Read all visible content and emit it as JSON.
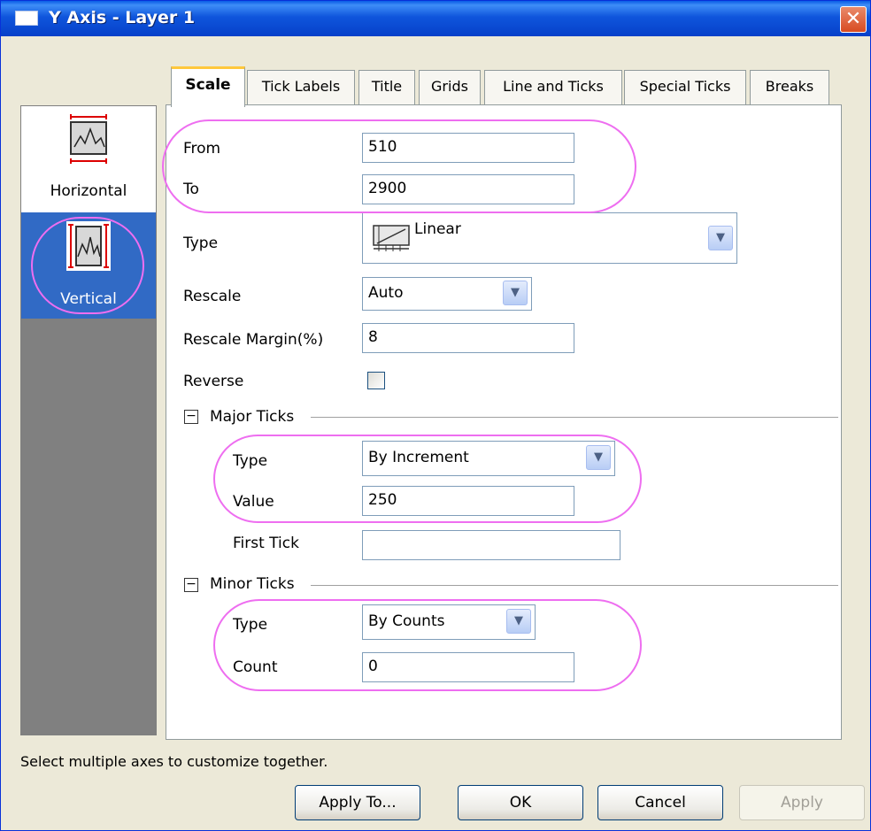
{
  "window": {
    "title": "Y Axis - Layer 1",
    "close_glyph": "✕"
  },
  "left_panel": {
    "items": [
      {
        "label": "Horizontal",
        "icon": "horizontal-axis-icon",
        "selected": false
      },
      {
        "label": "Vertical",
        "icon": "vertical-axis-icon",
        "selected": true
      }
    ]
  },
  "tabs": [
    {
      "label": "Scale",
      "active": true
    },
    {
      "label": "Tick Labels"
    },
    {
      "label": "Title"
    },
    {
      "label": "Grids"
    },
    {
      "label": "Line and Ticks"
    },
    {
      "label": "Special Ticks"
    },
    {
      "label": "Breaks"
    }
  ],
  "scale": {
    "from_label": "From",
    "from_value": "510",
    "to_label": "To",
    "to_value": "2900",
    "type_label": "Type",
    "type_value": "Linear",
    "type_icon": "linear-scale-icon",
    "rescale_label": "Rescale",
    "rescale_value": "Auto",
    "rescale_margin_label": "Rescale Margin(%)",
    "rescale_margin_value": "8",
    "reverse_label": "Reverse",
    "reverse_checked": false
  },
  "major_ticks": {
    "header": "Major Ticks",
    "expander_glyph": "−",
    "type_label": "Type",
    "type_value": "By Increment",
    "value_label": "Value",
    "value_value": "250",
    "first_tick_label": "First Tick",
    "first_tick_value": ""
  },
  "minor_ticks": {
    "header": "Minor Ticks",
    "expander_glyph": "−",
    "type_label": "Type",
    "type_value": "By Counts",
    "count_label": "Count",
    "count_value": "0"
  },
  "status_text": "Select multiple axes to customize together.",
  "buttons": {
    "apply_to": "Apply To...",
    "ok": "OK",
    "cancel": "Cancel",
    "apply": "Apply"
  },
  "colors": {
    "title_bar": "#0a5ce6",
    "selection": "#316ac5",
    "highlight_oval": "#ee6ef0",
    "close_button": "#d84b21"
  },
  "combo_arrow": "▼"
}
